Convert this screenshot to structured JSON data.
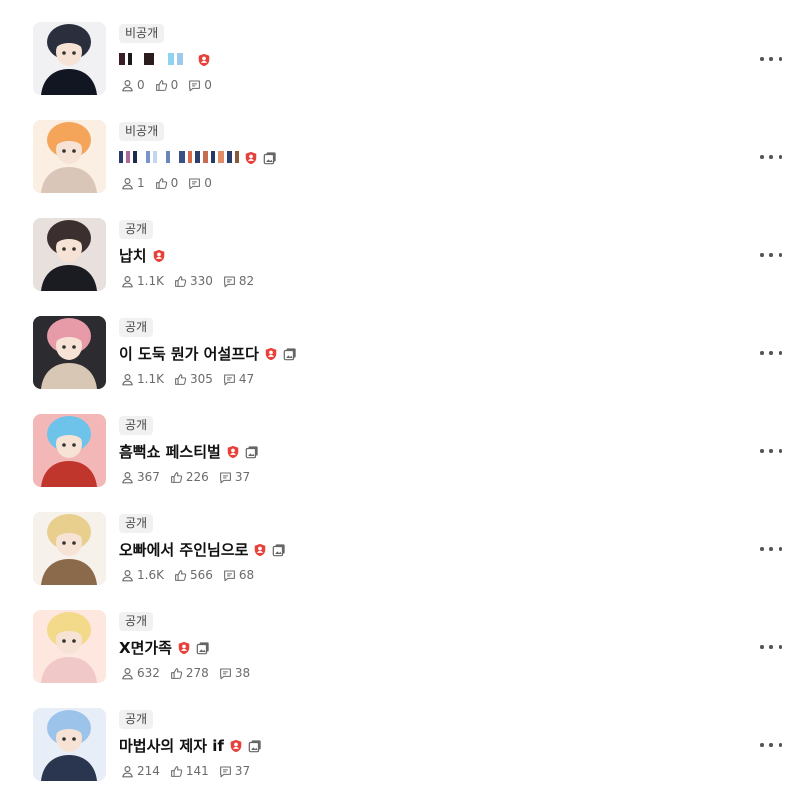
{
  "items": [
    {
      "visibility": "비공개",
      "title": "",
      "title_redacted": true,
      "has_gallery": false,
      "stats": {
        "users": "0",
        "likes": "0",
        "comments": "0"
      },
      "thumb_colors": [
        "#2a2e3d",
        "#f1f1f4",
        "#121522"
      ]
    },
    {
      "visibility": "비공개",
      "title": "",
      "title_redacted": true,
      "has_gallery": true,
      "stats": {
        "users": "1",
        "likes": "0",
        "comments": "0"
      },
      "thumb_colors": [
        "#f4a55a",
        "#fbeee2",
        "#d9c6b8"
      ]
    },
    {
      "visibility": "공개",
      "title": "납치",
      "title_redacted": false,
      "has_gallery": false,
      "stats": {
        "users": "1.1K",
        "likes": "330",
        "comments": "82"
      },
      "thumb_colors": [
        "#3b2f2f",
        "#e8e0dc",
        "#1b1c22"
      ]
    },
    {
      "visibility": "공개",
      "title": "이 도둑 뭔가 어설프다",
      "title_redacted": false,
      "has_gallery": true,
      "stats": {
        "users": "1.1K",
        "likes": "305",
        "comments": "47"
      },
      "thumb_colors": [
        "#e79aa7",
        "#2b2b30",
        "#d8c7b4"
      ]
    },
    {
      "visibility": "공개",
      "title": "흠뻑쇼 페스티벌",
      "title_redacted": false,
      "has_gallery": true,
      "stats": {
        "users": "367",
        "likes": "226",
        "comments": "37"
      },
      "thumb_colors": [
        "#6ec3ea",
        "#f3b7b7",
        "#c0352c"
      ]
    },
    {
      "visibility": "공개",
      "title": "오빠에서 주인님으로",
      "title_redacted": false,
      "has_gallery": true,
      "stats": {
        "users": "1.6K",
        "likes": "566",
        "comments": "68"
      },
      "thumb_colors": [
        "#e8cf8e",
        "#f6f1ea",
        "#8b6a4b"
      ]
    },
    {
      "visibility": "공개",
      "title": "X면가족",
      "title_redacted": false,
      "has_gallery": true,
      "stats": {
        "users": "632",
        "likes": "278",
        "comments": "38"
      },
      "thumb_colors": [
        "#f2da8a",
        "#fde7de",
        "#f0c8c8"
      ]
    },
    {
      "visibility": "공개",
      "title": "마법사의 제자 if",
      "title_redacted": false,
      "has_gallery": true,
      "stats": {
        "users": "214",
        "likes": "141",
        "comments": "37"
      },
      "thumb_colors": [
        "#9cc3ea",
        "#e7eef7",
        "#2a3550"
      ]
    }
  ],
  "colors": {
    "restricted_badge": "#e8403a",
    "stat_text": "#6b6b6b",
    "badge_bg": "#f1f1f1"
  }
}
